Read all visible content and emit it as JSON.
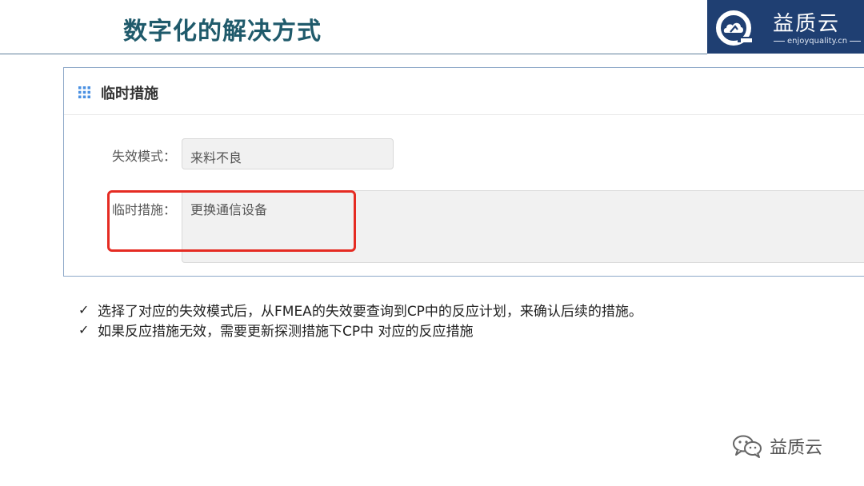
{
  "slide": {
    "title": "数字化的解决方式"
  },
  "logo": {
    "name": "益质云",
    "domain": "enjoyquality.cn"
  },
  "panel": {
    "title": "临时措施",
    "fields": [
      {
        "label": "失效模式：",
        "value": "来料不良"
      },
      {
        "label": "临时措施：",
        "value": "更换通信设备"
      }
    ]
  },
  "bullets": [
    {
      "mark": "✓",
      "text": "选择了对应的失效模式后，从FMEA的失效要查询到CP中的反应计划，来确认后续的措施。"
    },
    {
      "mark": "✓",
      "text": "如果反应措施无效，需要更新探测措施下CP中 对应的反应措施"
    }
  ],
  "watermark": {
    "text": "益质云"
  },
  "colors": {
    "title": "#1f5a6b",
    "logo_bg": "#1f3f72",
    "highlight": "#e52b22",
    "panel_border": "#8ea8c8"
  }
}
